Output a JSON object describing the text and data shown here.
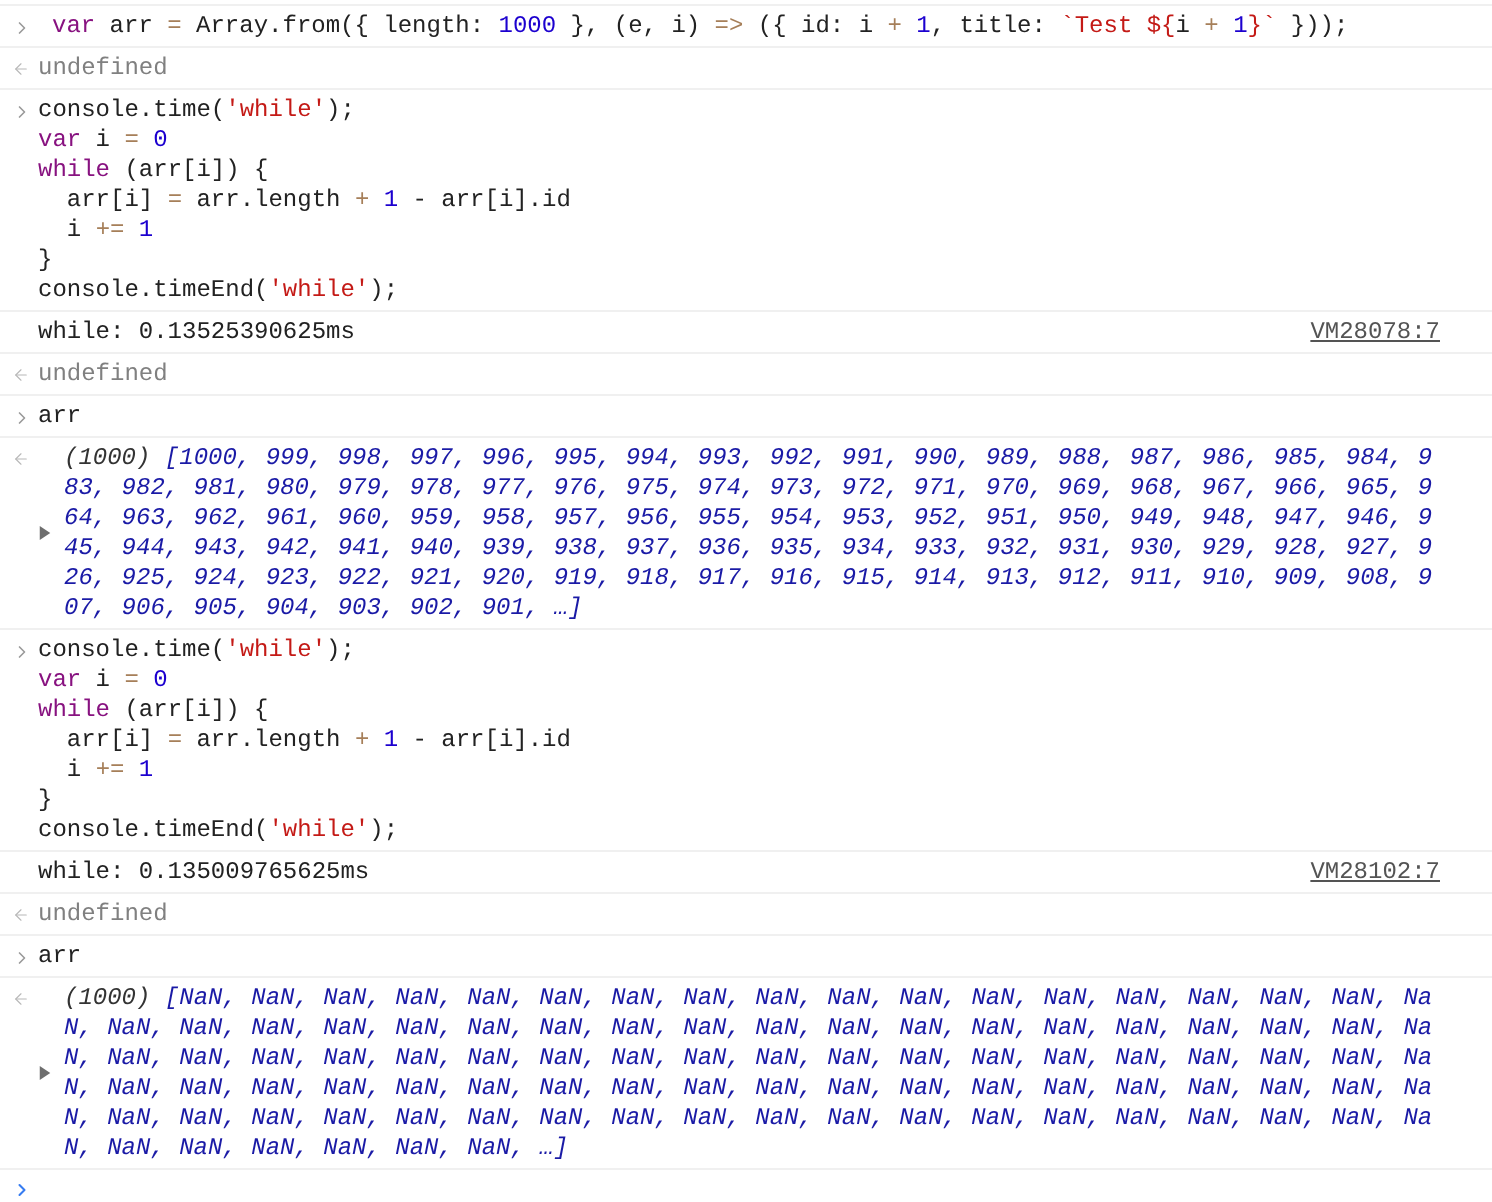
{
  "entries": [
    {
      "kind": "input",
      "lines": [
        [
          {
            "kind": "keyword",
            "text": "var"
          },
          {
            "kind": "plain",
            "text": " arr "
          },
          {
            "kind": "operator",
            "text": "="
          },
          {
            "kind": "plain",
            "text": " Array.from({ length: "
          },
          {
            "kind": "number",
            "text": "1000"
          },
          {
            "kind": "plain",
            "text": " }, (e, i) "
          },
          {
            "kind": "operator",
            "text": "=>"
          },
          {
            "kind": "plain",
            "text": " ({ id: i "
          },
          {
            "kind": "operator",
            "text": "+ "
          },
          {
            "kind": "number",
            "text": "1"
          },
          {
            "kind": "plain",
            "text": ", title: "
          },
          {
            "kind": "string",
            "text": "`Test ${"
          },
          {
            "kind": "plain",
            "text": "i "
          },
          {
            "kind": "operator",
            "text": "+ "
          },
          {
            "kind": "number",
            "text": "1"
          },
          {
            "kind": "string",
            "text": "}`"
          },
          {
            "kind": "plain",
            "text": " }));"
          }
        ]
      ]
    },
    {
      "kind": "result",
      "text": "undefined"
    },
    {
      "kind": "input",
      "lines": [
        [
          {
            "kind": "plain",
            "text": "console.time("
          },
          {
            "kind": "string",
            "text": "'while'"
          },
          {
            "kind": "plain",
            "text": ");"
          }
        ],
        [
          {
            "kind": "keyword",
            "text": "var"
          },
          {
            "kind": "plain",
            "text": " i "
          },
          {
            "kind": "operator",
            "text": "= "
          },
          {
            "kind": "number",
            "text": "0"
          }
        ],
        [
          {
            "kind": "keyword",
            "text": "while"
          },
          {
            "kind": "plain",
            "text": " (arr[i]) {"
          }
        ],
        [
          {
            "kind": "plain",
            "text": "  arr[i] "
          },
          {
            "kind": "operator",
            "text": "="
          },
          {
            "kind": "plain",
            "text": " arr.length "
          },
          {
            "kind": "operator",
            "text": "+ "
          },
          {
            "kind": "number",
            "text": "1"
          },
          {
            "kind": "plain",
            "text": " - arr[i].id"
          }
        ],
        [
          {
            "kind": "plain",
            "text": "  i "
          },
          {
            "kind": "operator",
            "text": "+= "
          },
          {
            "kind": "number",
            "text": "1"
          }
        ],
        [
          {
            "kind": "plain",
            "text": "}"
          }
        ],
        [
          {
            "kind": "plain",
            "text": "console.timeEnd("
          },
          {
            "kind": "string",
            "text": "'while'"
          },
          {
            "kind": "plain",
            "text": ");"
          }
        ]
      ]
    },
    {
      "kind": "log",
      "text": "while: 0.13525390625ms",
      "source": "VM28078:7"
    },
    {
      "kind": "result",
      "text": "undefined"
    },
    {
      "kind": "input",
      "lines": [
        [
          {
            "kind": "plain",
            "text": "arr"
          }
        ]
      ]
    },
    {
      "kind": "array",
      "expanded": false,
      "count": "(1000)",
      "lines": [
        "[1000, 999, 998, 997, 996, 995, 994, 993, 992, 991, 990, 989, 988, 987, 986, 985, 984, 9",
        "83, 982, 981, 980, 979, 978, 977, 976, 975, 974, 973, 972, 971, 970, 969, 968, 967, 966, 965, 9",
        "64, 963, 962, 961, 960, 959, 958, 957, 956, 955, 954, 953, 952, 951, 950, 949, 948, 947, 946, 9",
        "45, 944, 943, 942, 941, 940, 939, 938, 937, 936, 935, 934, 933, 932, 931, 930, 929, 928, 927, 9",
        "26, 925, 924, 923, 922, 921, 920, 919, 918, 917, 916, 915, 914, 913, 912, 911, 910, 909, 908, 9",
        "07, 906, 905, 904, 903, 902, 901, …]"
      ]
    },
    {
      "kind": "input",
      "lines": [
        [
          {
            "kind": "plain",
            "text": "console.time("
          },
          {
            "kind": "string",
            "text": "'while'"
          },
          {
            "kind": "plain",
            "text": ");"
          }
        ],
        [
          {
            "kind": "keyword",
            "text": "var"
          },
          {
            "kind": "plain",
            "text": " i "
          },
          {
            "kind": "operator",
            "text": "= "
          },
          {
            "kind": "number",
            "text": "0"
          }
        ],
        [
          {
            "kind": "keyword",
            "text": "while"
          },
          {
            "kind": "plain",
            "text": " (arr[i]) {"
          }
        ],
        [
          {
            "kind": "plain",
            "text": "  arr[i] "
          },
          {
            "kind": "operator",
            "text": "="
          },
          {
            "kind": "plain",
            "text": " arr.length "
          },
          {
            "kind": "operator",
            "text": "+ "
          },
          {
            "kind": "number",
            "text": "1"
          },
          {
            "kind": "plain",
            "text": " - arr[i].id"
          }
        ],
        [
          {
            "kind": "plain",
            "text": "  i "
          },
          {
            "kind": "operator",
            "text": "+= "
          },
          {
            "kind": "number",
            "text": "1"
          }
        ],
        [
          {
            "kind": "plain",
            "text": "}"
          }
        ],
        [
          {
            "kind": "plain",
            "text": "console.timeEnd("
          },
          {
            "kind": "string",
            "text": "'while'"
          },
          {
            "kind": "plain",
            "text": ");"
          }
        ]
      ]
    },
    {
      "kind": "log",
      "text": "while: 0.135009765625ms",
      "source": "VM28102:7"
    },
    {
      "kind": "result",
      "text": "undefined"
    },
    {
      "kind": "input",
      "lines": [
        [
          {
            "kind": "plain",
            "text": "arr"
          }
        ]
      ]
    },
    {
      "kind": "array",
      "expanded": false,
      "count": "(1000)",
      "lines": [
        "[NaN, NaN, NaN, NaN, NaN, NaN, NaN, NaN, NaN, NaN, NaN, NaN, NaN, NaN, NaN, NaN, NaN, Na",
        "N, NaN, NaN, NaN, NaN, NaN, NaN, NaN, NaN, NaN, NaN, NaN, NaN, NaN, NaN, NaN, NaN, NaN, NaN, Na",
        "N, NaN, NaN, NaN, NaN, NaN, NaN, NaN, NaN, NaN, NaN, NaN, NaN, NaN, NaN, NaN, NaN, NaN, NaN, Na",
        "N, NaN, NaN, NaN, NaN, NaN, NaN, NaN, NaN, NaN, NaN, NaN, NaN, NaN, NaN, NaN, NaN, NaN, NaN, Na",
        "N, NaN, NaN, NaN, NaN, NaN, NaN, NaN, NaN, NaN, NaN, NaN, NaN, NaN, NaN, NaN, NaN, NaN, NaN, Na",
        "N, NaN, NaN, NaN, NaN, NaN, NaN, …]"
      ]
    },
    {
      "kind": "prompt"
    }
  ]
}
